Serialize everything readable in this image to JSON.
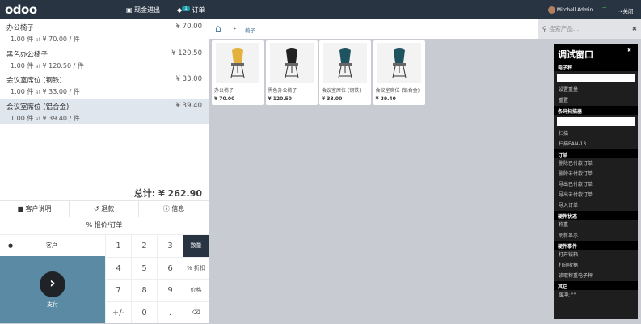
{
  "header": {
    "logo": "odoo",
    "cash": "现金进出",
    "orders": "订单",
    "orders_count": "1",
    "user": "Mitchell Admin",
    "close": "关闭"
  },
  "order": {
    "lines": [
      {
        "name": "办公椅子",
        "price": "¥ 70.00",
        "qty": "1.00 件",
        "at": "at",
        "unit": "¥ 70.00 / 件"
      },
      {
        "name": "黑色办公椅子",
        "price": "¥ 120.50",
        "qty": "1.00 件",
        "at": "at",
        "unit": "¥ 120.50 / 件"
      },
      {
        "name": "会议室席位 (钢铁)",
        "price": "¥ 33.00",
        "qty": "1.00 件",
        "at": "at",
        "unit": "¥ 33.00 / 件"
      },
      {
        "name": "会议室席位 (铝合金)",
        "price": "¥ 39.40",
        "qty": "1.00 件",
        "at": "at",
        "unit": "¥ 39.40 / 件",
        "selected": true
      }
    ],
    "total_label": "总计:",
    "total": "¥ 262.90"
  },
  "controls": {
    "note": "客户说明",
    "refund": "退款",
    "info": "信息",
    "quote": "报价/订单",
    "customer": "客户",
    "pay": "支付"
  },
  "numpad": {
    "keys": [
      "1",
      "2",
      "3",
      "数量",
      "4",
      "5",
      "6",
      "% 折扣",
      "7",
      "8",
      "9",
      "价格",
      "+/-",
      "0",
      ".",
      "⌫"
    ]
  },
  "breadcrumb": {
    "category": "椅子"
  },
  "search": {
    "placeholder": "搜索产品..."
  },
  "products": [
    {
      "name": "办公椅子",
      "price": "¥ 70.00"
    },
    {
      "name": "黑色办公椅子",
      "price": "¥ 120.50"
    },
    {
      "name": "会议室席位 (钢铁)",
      "price": "¥ 33.00"
    },
    {
      "name": "会议室席位 (铝合金)",
      "price": "¥ 39.40"
    }
  ],
  "debug": {
    "title": "调试窗口",
    "sections": [
      {
        "title": "电子秤",
        "input": true,
        "items": [
          "设置重量",
          "重置"
        ]
      },
      {
        "title": "条码扫描器",
        "input": true,
        "items": [
          "扫描",
          "扫描EAN-13"
        ]
      },
      {
        "title": "订单",
        "items": [
          "删除已付款订单",
          "删除未付款订单",
          "导出已付款订单",
          "导出未付款订单",
          "导入订单"
        ]
      },
      {
        "title": "硬件状态",
        "items": [
          "称重",
          "刷新显示"
        ]
      },
      {
        "title": "硬件事件",
        "items": [
          "打开钱箱",
          "打印收据",
          "读取称重电子秤"
        ]
      },
      {
        "title": "其它",
        "items": [
          "缓冲: \"\""
        ]
      }
    ]
  },
  "colors": {
    "topbar": "#283442",
    "pay": "#5b8aa5",
    "selected_line": "#dfe6ee",
    "active_key": "#283442"
  }
}
